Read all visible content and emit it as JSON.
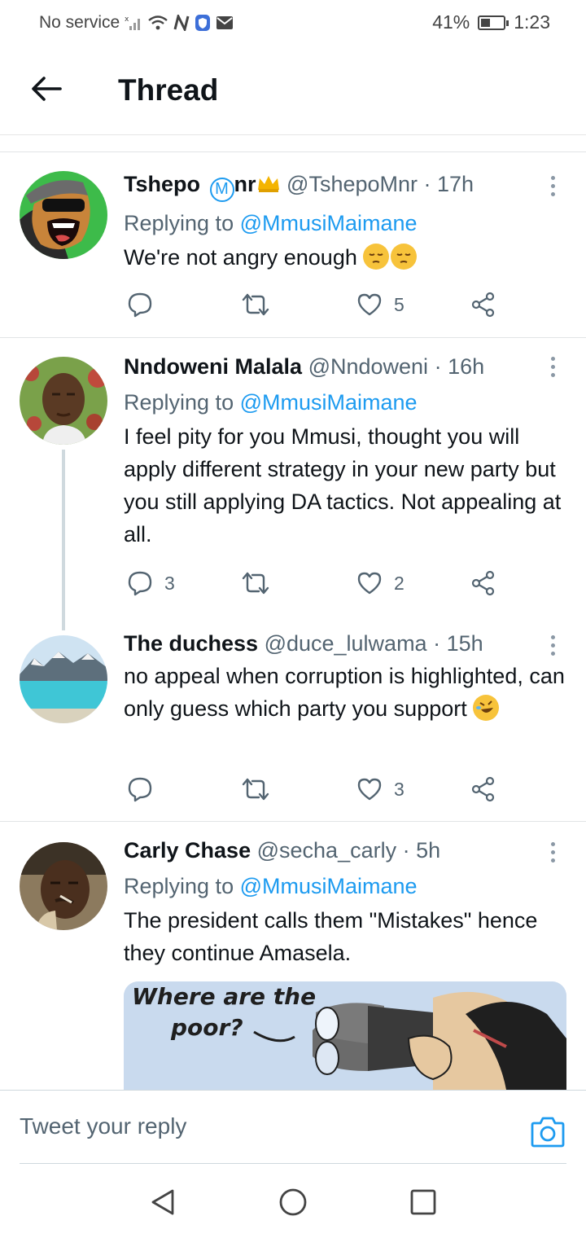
{
  "status": {
    "carrier": "No service",
    "battery_percent": "41%",
    "battery_level": 0.41,
    "time": "1:23"
  },
  "header": {
    "title": "Thread"
  },
  "tweets": [
    {
      "display_name": "Tshepo",
      "badge_letter": "M",
      "name_suffix": "nr",
      "handle": "@TshepoMnr",
      "time": "· 17h",
      "replying_label": "Replying to",
      "replying_to": "@MmusiMaimane",
      "text": "We're not angry enough",
      "emojis": [
        "pensive-face",
        "pensive-face"
      ],
      "reply_count": "",
      "retweet_count": "",
      "like_count": "5"
    },
    {
      "display_name": "Nndoweni Malala",
      "handle": "@Nndoweni",
      "time": "· 16h",
      "replying_label": "Replying to",
      "replying_to": "@MmusiMaimane",
      "text": "I feel pity for you Mmusi, thought you will apply different strategy in your new party but you still applying DA tactics. Not appealing at all.",
      "reply_count": "3",
      "retweet_count": "",
      "like_count": "2"
    },
    {
      "display_name": "The duchess",
      "handle": "@duce_lulwama",
      "time": "· 15h",
      "text": "no appeal when corruption is highlighted, can only guess which party you support",
      "emojis": [
        "rolling-on-floor-laughing"
      ],
      "reply_count": "",
      "retweet_count": "",
      "like_count": "3"
    },
    {
      "display_name": "Carly Chase",
      "handle": "@secha_carly",
      "time": "· 5h",
      "replying_label": "Replying to",
      "replying_to": "@MmusiMaimane",
      "text": "The president calls them \"Mistakes\" hence they continue Amasela.",
      "media": {
        "caption_line1": "Where are the",
        "caption_line2": "poor?"
      }
    }
  ],
  "reply_bar": {
    "placeholder": "Tweet your reply"
  },
  "colors": {
    "accent": "#1d9bf0",
    "text": "#0f1419",
    "secondary": "#536471"
  }
}
